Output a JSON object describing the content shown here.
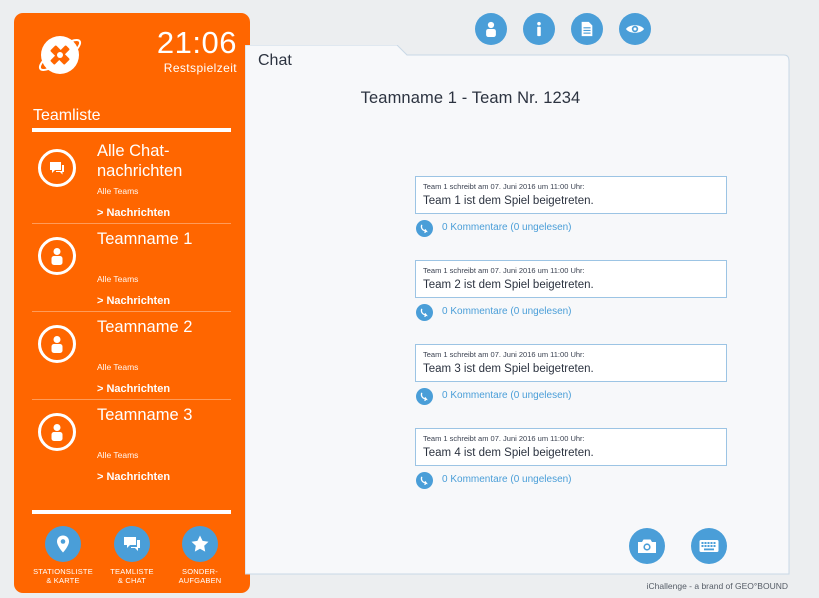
{
  "clock": {
    "time": "21:06",
    "label": "Restspielzeit"
  },
  "sidebar": {
    "heading": "Teamliste",
    "teams": [
      {
        "name": "Alle Chat-nachrichten",
        "sub": "Alle Teams",
        "link": "> Nachrichten",
        "icon": "chat-bubbles-icon"
      },
      {
        "name": "Teamname 1",
        "sub": "Alle Teams",
        "link": "> Nachrichten",
        "icon": "person-icon"
      },
      {
        "name": "Teamname 2",
        "sub": "Alle Teams",
        "link": "> Nachrichten",
        "icon": "person-icon"
      },
      {
        "name": "Teamname 3",
        "sub": "Alle Teams",
        "link": "> Nachrichten",
        "icon": "person-icon"
      }
    ],
    "nav": [
      {
        "line1": "STATIONSLISTE",
        "line2": "& KARTE",
        "icon": "map-pin-icon"
      },
      {
        "line1": "TEAMLISTE",
        "line2": "& CHAT",
        "icon": "chat-bubbles-icon"
      },
      {
        "line1": "SONDER-",
        "line2": "AUFGABEN",
        "icon": "star-icon"
      }
    ]
  },
  "top_icons": [
    "person-icon",
    "info-icon",
    "document-icon",
    "eye-icon"
  ],
  "main": {
    "tab": "Chat",
    "title": "Teamname 1 - Team Nr. 1234",
    "messages": [
      {
        "meta": "Team 1 schreibt am 07. Juni 2016 um 11:00 Uhr:",
        "text": "Team 1 ist dem Spiel beigetreten.",
        "comments": "0 Kommentare (0 ungelesen)"
      },
      {
        "meta": "Team 1 schreibt am 07. Juni 2016 um 11:00 Uhr:",
        "text": "Team 2 ist dem Spiel beigetreten.",
        "comments": "0 Kommentare (0 ungelesen)"
      },
      {
        "meta": "Team 1 schreibt am 07. Juni 2016 um 11:00 Uhr:",
        "text": "Team 3 ist dem Spiel beigetreten.",
        "comments": "0 Kommentare (0 ungelesen)"
      },
      {
        "meta": "Team 1 schreibt am 07. Juni 2016 um 11:00 Uhr:",
        "text": "Team 4 ist dem Spiel beigetreten.",
        "comments": "0 Kommentare (0 ungelesen)"
      }
    ],
    "actions": [
      "camera-icon",
      "keyboard-icon"
    ]
  },
  "footer": "iChallenge - a brand of GEO°BOUND",
  "colors": {
    "sidebar": "#ff6600",
    "accent": "#4a9ed8",
    "background": "#eceef0"
  }
}
